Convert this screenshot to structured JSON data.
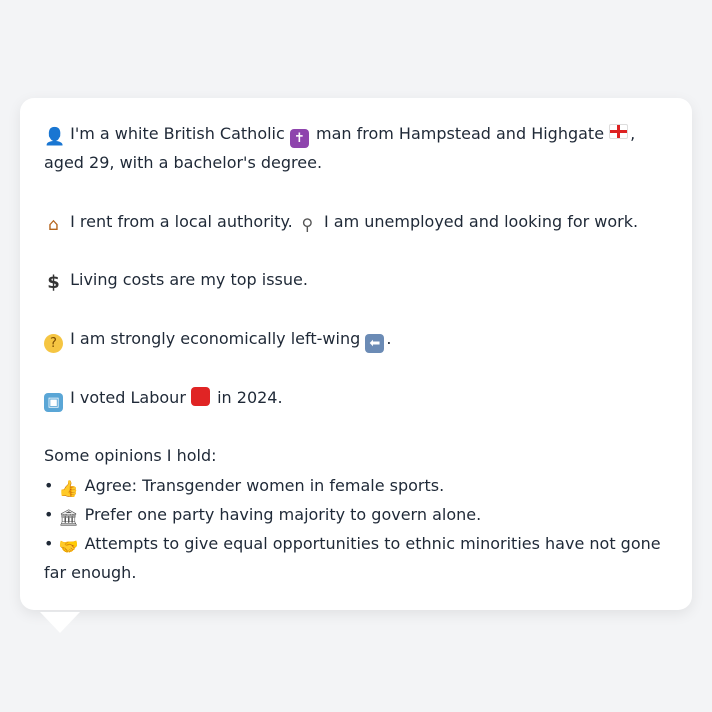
{
  "para1": {
    "icon1": "person-icon",
    "t1": "I'm a white British Catholic",
    "icon2": "latin-cross-icon",
    "t2": "man from Hampstead and Highgate",
    "icon3": "england-flag-icon",
    "t3": ", aged 29, with a bachelor's degree."
  },
  "para2": {
    "icon1": "house-icon",
    "t1": "I rent from a local authority.",
    "icon2": "magnifier-icon",
    "t2": "I am unemployed and looking for work."
  },
  "para3": {
    "icon1": "dollar-icon",
    "t1": "Living costs are my top issue."
  },
  "para4": {
    "icon1": "thinking-face-icon",
    "t1": "I am strongly economically left-wing",
    "icon2": "left-arrow-icon",
    "t2": "."
  },
  "para5": {
    "icon1": "ballot-box-icon",
    "t1": "I voted Labour",
    "icon2": "red-square-icon",
    "t2": "in 2024."
  },
  "opinions": {
    "heading": "Some opinions I hold:",
    "bullet": "•",
    "items": [
      {
        "icon": "thumbs-up-icon",
        "text": "Agree: Transgender women in female sports."
      },
      {
        "icon": "classical-building-icon",
        "text": "Prefer one party having majority to govern alone."
      },
      {
        "icon": "handshake-icon",
        "text": "Attempts to give equal opportunities to ethnic minorities have not gone far enough."
      }
    ]
  },
  "glyphs": {
    "person": "👤",
    "cross": "✝",
    "house": "⌂",
    "search": "⚲",
    "dollar": "$",
    "think": "?",
    "arrow": "⬅",
    "ballot": "▣",
    "thumb": "👍",
    "bank": "🏛",
    "shake": "🤝"
  },
  "colors": {
    "text": "#1f2937",
    "background": "#f3f4f6",
    "card": "#ffffff"
  }
}
